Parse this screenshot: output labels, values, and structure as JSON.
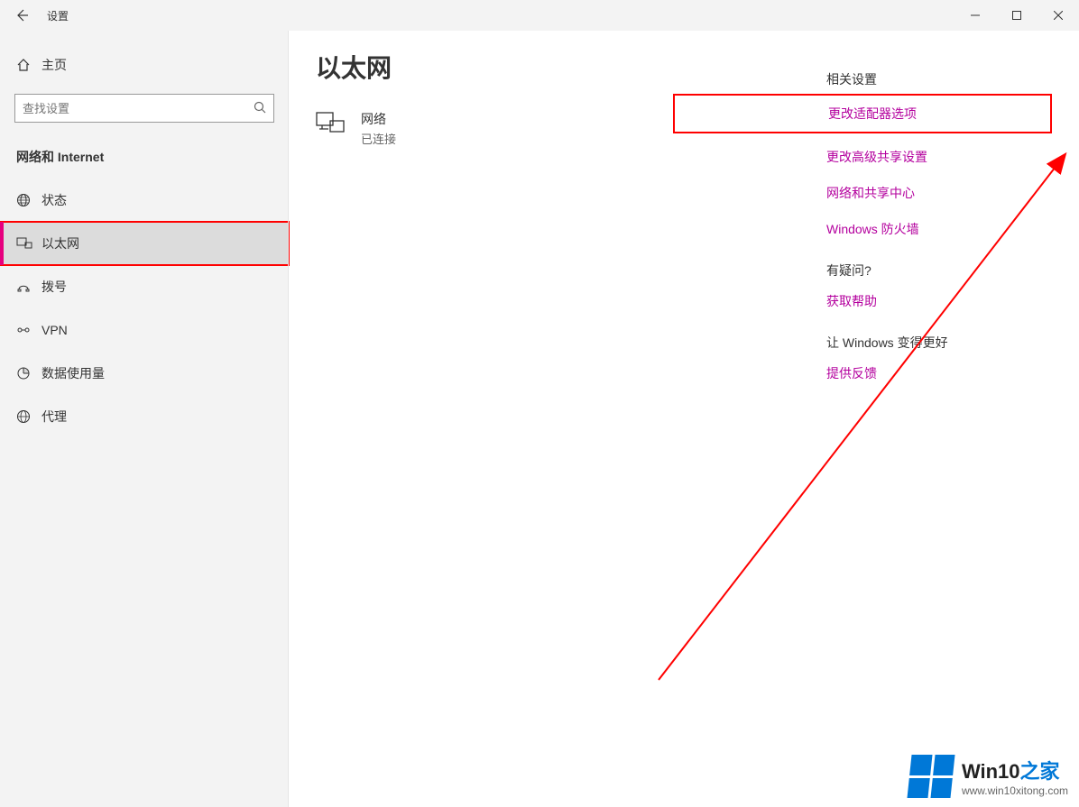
{
  "titlebar": {
    "title": "设置"
  },
  "sidebar": {
    "home_label": "主页",
    "search_placeholder": "查找设置",
    "category": "网络和 Internet",
    "items": [
      {
        "icon": "globe",
        "label": "状态"
      },
      {
        "icon": "ethernet",
        "label": "以太网",
        "active": true,
        "highlighted": true
      },
      {
        "icon": "dialup",
        "label": "拨号"
      },
      {
        "icon": "vpn",
        "label": "VPN"
      },
      {
        "icon": "data",
        "label": "数据使用量"
      },
      {
        "icon": "proxy",
        "label": "代理"
      }
    ]
  },
  "main": {
    "page_title": "以太网",
    "network": {
      "name": "网络",
      "status": "已连接"
    }
  },
  "related": {
    "heading": "相关设置",
    "links": [
      "更改适配器选项",
      "更改高级共享设置",
      "网络和共享中心",
      "Windows 防火墙"
    ],
    "question_heading": "有疑问?",
    "help_link": "获取帮助",
    "feedback_heading": "让 Windows 变得更好",
    "feedback_link": "提供反馈"
  },
  "watermark": {
    "line1_a": "Win10",
    "line1_b": "之家",
    "line2": "www.win10xitong.com"
  },
  "annotation": {
    "highlight_color": "#ff0000"
  }
}
